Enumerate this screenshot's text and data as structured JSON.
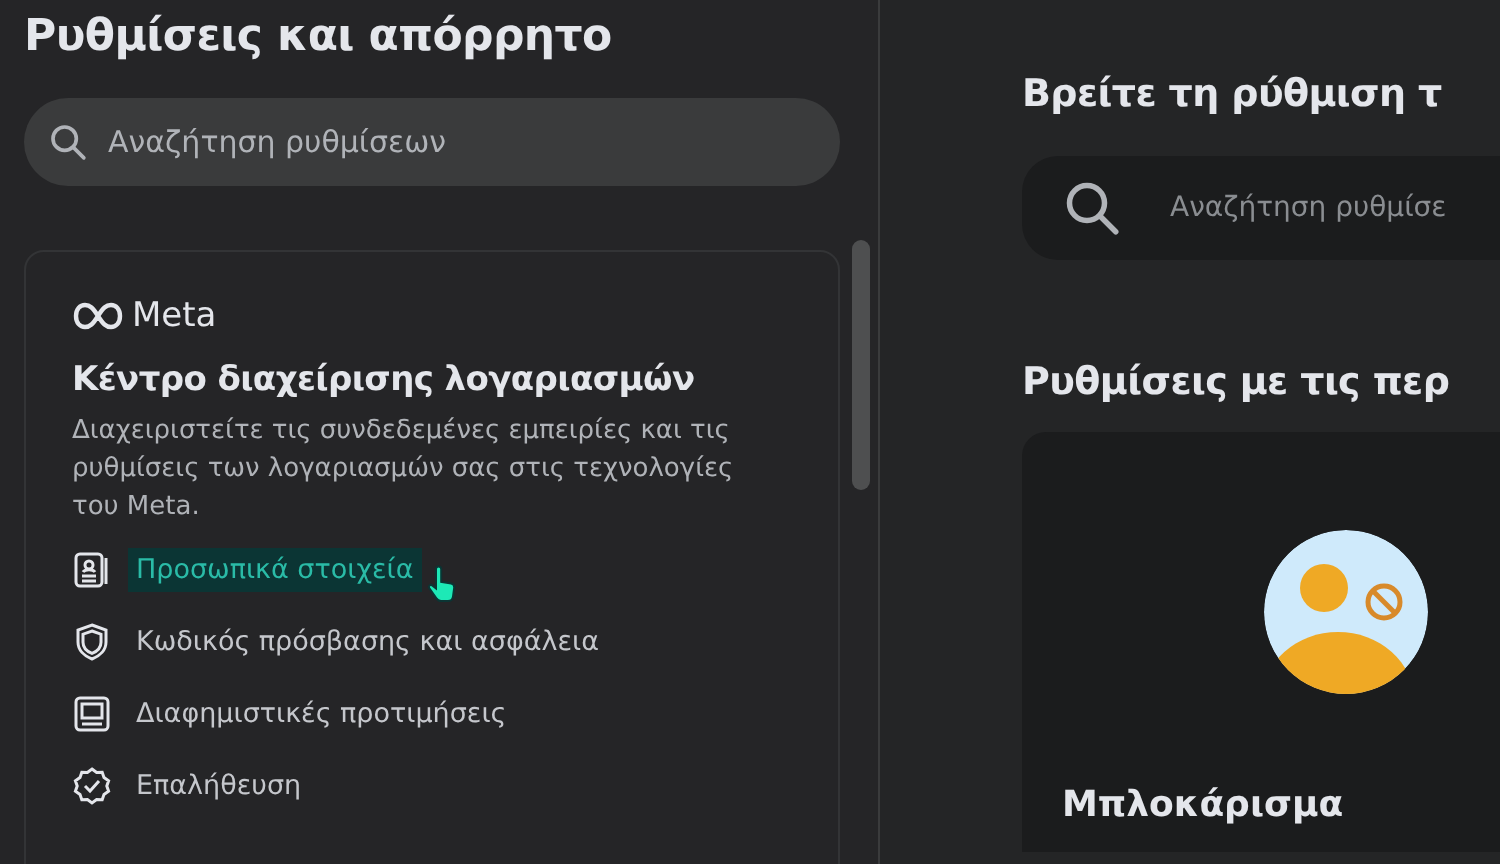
{
  "sidebar": {
    "title": "Ρυθμίσεις και απόρρητο",
    "search": {
      "placeholder": "Αναζήτηση ρυθμίσεων"
    },
    "accounts_card": {
      "brand": "Meta",
      "title": "Κέντρο διαχείρισης λογαριασμών",
      "description": "Διαχειριστείτε τις συνδεδεμένες εμπειρίες και τις ρυθμίσεις των λογαριασμών σας στις τεχνολογίες του Meta.",
      "items": [
        {
          "kind": "id-card",
          "label": "Προσωπικά στοιχεία",
          "selected": true
        },
        {
          "kind": "shield",
          "label": "Κωδικός πρόσβασης και ασφάλεια",
          "selected": false
        },
        {
          "kind": "monitor",
          "label": "Διαφημιστικές προτιμήσεις",
          "selected": false
        },
        {
          "kind": "badge",
          "label": "Επαλήθευση",
          "selected": false
        }
      ]
    }
  },
  "main": {
    "heading": "Βρείτε τη ρύθμιση τ",
    "search": {
      "placeholder": "Αναζήτηση ρυθμίσε"
    },
    "section_heading": "Ρυθμίσεις με τις περ",
    "cards": [
      {
        "title": "Μπλοκάρισμα"
      }
    ]
  }
}
